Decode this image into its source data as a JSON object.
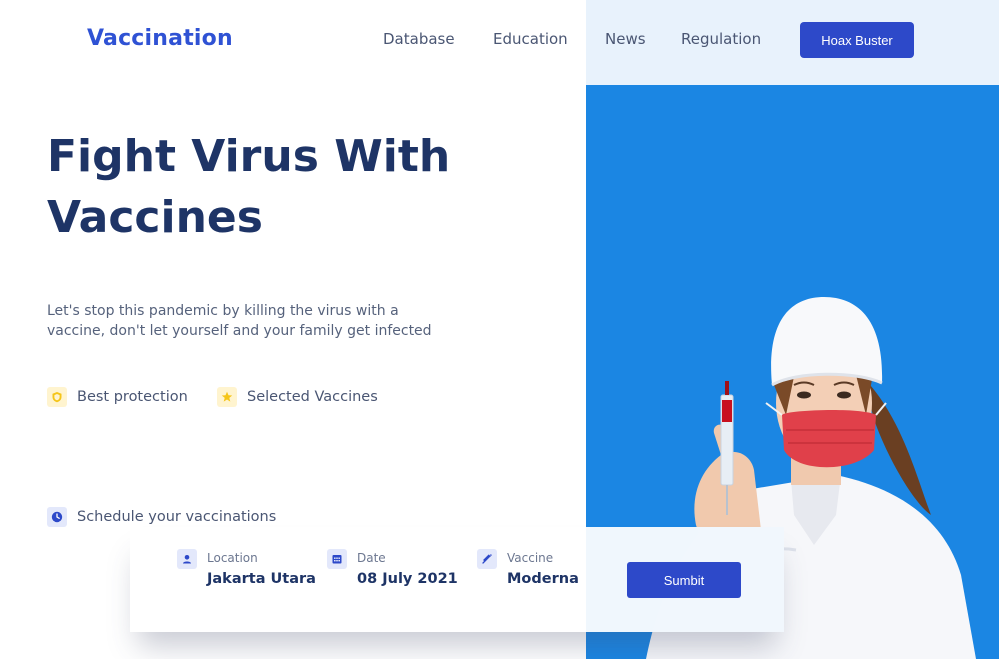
{
  "header": {
    "logo": "Vaccination",
    "nav": [
      "Database",
      "Education",
      "News",
      "Regulation"
    ],
    "cta_label": "Hoax Buster"
  },
  "hero": {
    "title_line1": "Fight Virus With",
    "title_line2": "Vaccines",
    "description": "Let's stop this pandemic by killing the virus with a vaccine, don't let yourself and your family get infected",
    "features": [
      {
        "label": "Best protection",
        "icon": "shield-icon"
      },
      {
        "label": "Selected Vaccines",
        "icon": "star-icon"
      }
    ]
  },
  "schedule": {
    "label": "Schedule your vaccinations",
    "icon": "clock-icon",
    "fields": [
      {
        "label": "Location",
        "value": "Jakarta Utara",
        "icon": "location-icon"
      },
      {
        "label": "Date",
        "value": "08 July 2021",
        "icon": "calendar-icon"
      },
      {
        "label": "Vaccine",
        "value": "Moderna",
        "icon": "syringe-icon"
      }
    ],
    "submit_label": "Sumbit"
  },
  "colors": {
    "brand_blue": "#2f52d4",
    "button_blue": "#2d49c9",
    "panel_blue": "#1b86e3",
    "title_navy": "#1e3466",
    "feature_yellow": "#f5c518"
  }
}
